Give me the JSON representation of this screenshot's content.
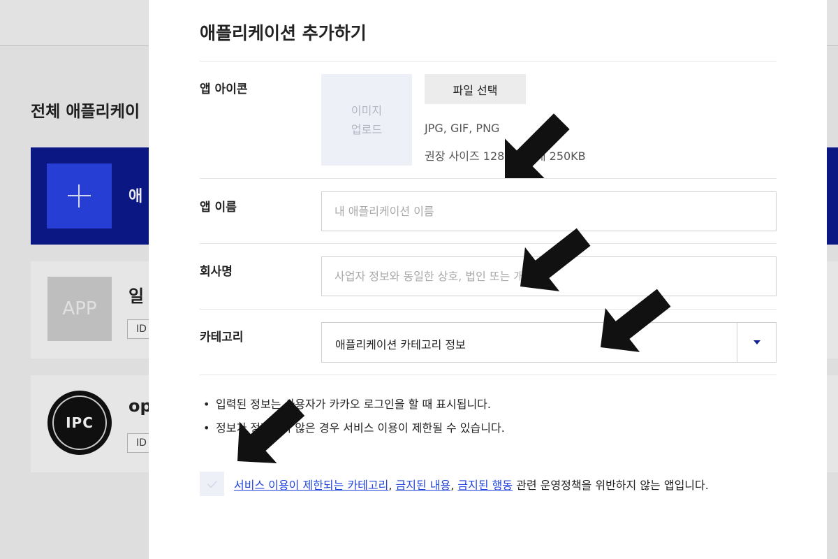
{
  "background": {
    "section_title": "전체 애플리케이",
    "add_card_label": "애",
    "apps": [
      {
        "thumb_text": "APP",
        "name": "일",
        "id_badge": "ID"
      },
      {
        "thumb_text": "IPC",
        "name": "op",
        "id_badge": "ID"
      }
    ]
  },
  "modal": {
    "title": "애플리케이션 추가하기",
    "icon_row": {
      "label": "앱 아이콘",
      "upload_line1": "이미지",
      "upload_line2": "업로드",
      "file_button": "파일 선택",
      "hint_formats": "JPG, GIF, PNG",
      "hint_size": "권장 사이즈 128px, 최대 250KB"
    },
    "name_row": {
      "label": "앱 이름",
      "value": "",
      "placeholder": "내 애플리케이션 이름"
    },
    "company_row": {
      "label": "회사명",
      "value": "",
      "placeholder": "사업자 정보와 동일한 상호, 법인 또는 개인명"
    },
    "category_row": {
      "label": "카테고리",
      "selected": "애플리케이션 카테고리 정보"
    },
    "notes": [
      "입력된 정보는 사용자가 카카오 로그인을 할 때 표시됩니다.",
      "정보가 정확하지 않은 경우 서비스 이용이 제한될 수 있습니다."
    ],
    "agreement": {
      "checked": false,
      "link1": "서비스 이용이 제한되는 카테고리",
      "sep1": ", ",
      "link2": "금지된 내용",
      "sep2": ", ",
      "link3": "금지된 행동",
      "suffix": " 관련 운영정책을 위반하지 않는 앱입니다."
    }
  },
  "colors": {
    "accent": "#2244dd",
    "brand_navy": "#0c1a8f",
    "arrow": "#111111"
  },
  "icons": [
    "plus-icon",
    "chevron-down-icon",
    "check-icon",
    "arrow-icon"
  ]
}
